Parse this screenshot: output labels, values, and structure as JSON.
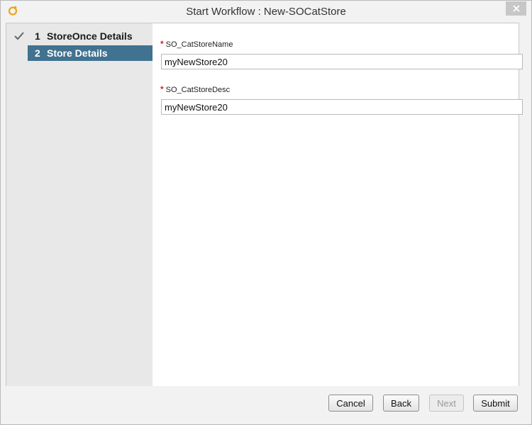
{
  "window": {
    "title": "Start Workflow : New-SOCatStore",
    "logo_icon": "app-logo-icon",
    "close_icon": "close-icon",
    "brand_color": "#f0a31c"
  },
  "sidebar": {
    "active_color": "#41728f",
    "steps": [
      {
        "number": "1",
        "label": "StoreOnce Details",
        "completed": true,
        "active": false
      },
      {
        "number": "2",
        "label": "Store Details",
        "completed": false,
        "active": true
      }
    ]
  },
  "form": {
    "required_marker": "*",
    "fields": [
      {
        "label": "SO_CatStoreName",
        "value": "myNewStore20",
        "required": true
      },
      {
        "label": "SO_CatStoreDesc",
        "value": "myNewStore20",
        "required": true
      }
    ]
  },
  "footer": {
    "cancel_label": "Cancel",
    "back_label": "Back",
    "next_label": "Next",
    "next_enabled": false,
    "submit_label": "Submit"
  }
}
